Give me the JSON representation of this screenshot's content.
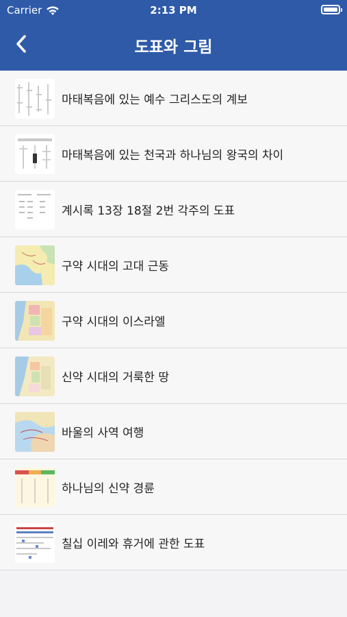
{
  "status_bar": {
    "carrier": "Carrier",
    "time": "2:13 PM"
  },
  "nav": {
    "title": "도표와 그림",
    "back_icon": "chevron-left-icon"
  },
  "colors": {
    "header": "#2f5aa8",
    "background": "#f3f3f5",
    "separator": "#d8d8dc"
  },
  "items": [
    {
      "label": "마태복음에 있는 예수 그리스도의 계보"
    },
    {
      "label": "마태복음에 있는 천국과 하나님의 왕국의 차이"
    },
    {
      "label": "계시록 13장 18절 2번 각주의 도표"
    },
    {
      "label": "구약 시대의 고대 근동"
    },
    {
      "label": "구약 시대의 이스라엘"
    },
    {
      "label": "신약 시대의 거룩한 땅"
    },
    {
      "label": "바울의 사역 여행"
    },
    {
      "label": "하나님의 신약 경륜"
    },
    {
      "label": "칠십 이레와 휴거에 관한 도표"
    }
  ]
}
